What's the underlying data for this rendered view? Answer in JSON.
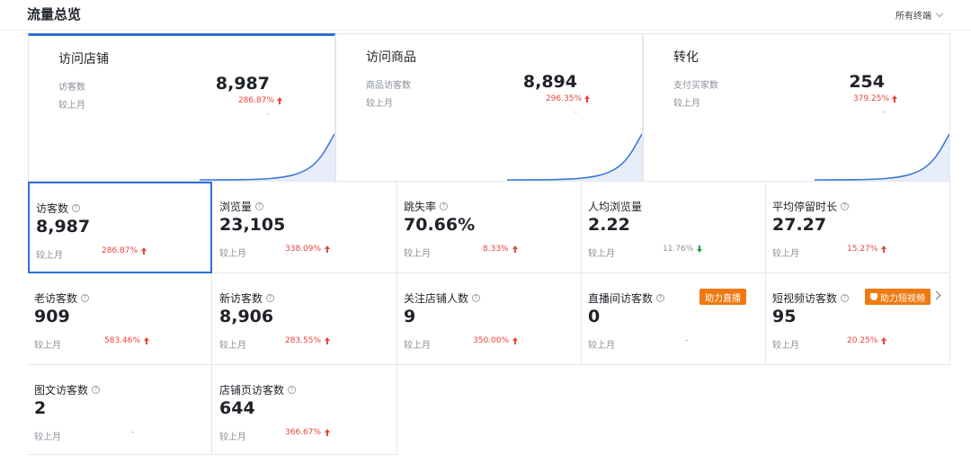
{
  "header": {
    "title": "流量总览",
    "terminal": "所有终端"
  },
  "top_cards": [
    {
      "name": "访问店铺",
      "metric_label": "访客数",
      "value": "8,987",
      "compare_label": "较上月",
      "pct": "286.87%",
      "dash": "-"
    },
    {
      "name": "访问商品",
      "metric_label": "商品访客数",
      "value": "8,894",
      "compare_label": "较上月",
      "pct": "296.35%",
      "dash": "-"
    },
    {
      "name": "转化",
      "metric_label": "支付买家数",
      "value": "254",
      "compare_label": "较上月",
      "pct": "379.25%",
      "dash": "-"
    }
  ],
  "metrics": [
    {
      "label": "访客数",
      "value": "8,987",
      "compare_label": "较上月",
      "pct": "286.87%",
      "trend": "up"
    },
    {
      "label": "浏览量",
      "value": "23,105",
      "compare_label": "较上月",
      "pct": "338.09%",
      "trend": "up"
    },
    {
      "label": "跳失率",
      "value": "70.66%",
      "compare_label": "较上月",
      "pct": "8.33%",
      "trend": "up"
    },
    {
      "label": "人均浏览量",
      "value": "2.22",
      "compare_label": "较上月",
      "pct": "11.76%",
      "trend": "down"
    },
    {
      "label": "平均停留时长",
      "value": "27.27",
      "compare_label": "较上月",
      "pct": "15.27%",
      "trend": "up"
    },
    {
      "label": "老访客数",
      "value": "909",
      "compare_label": "较上月",
      "pct": "583.46%",
      "trend": "up"
    },
    {
      "label": "新访客数",
      "value": "8,906",
      "compare_label": "较上月",
      "pct": "283.55%",
      "trend": "up"
    },
    {
      "label": "关注店铺人数",
      "value": "9",
      "compare_label": "较上月",
      "pct": "350.00%",
      "trend": "up"
    },
    {
      "label": "直播间访客数",
      "value": "0",
      "compare_label": "较上月",
      "pct": "-",
      "trend": "none",
      "badge": "助力直播"
    },
    {
      "label": "短视频访客数",
      "value": "95",
      "compare_label": "较上月",
      "pct": "20.25%",
      "trend": "up",
      "badge": "助力短视频"
    },
    {
      "label": "图文访客数",
      "value": "2",
      "compare_label": "较上月",
      "pct": "-",
      "trend": "none"
    },
    {
      "label": "店铺页访客数",
      "value": "644",
      "compare_label": "较上月",
      "pct": "366.67%",
      "trend": "up"
    }
  ],
  "colors": {
    "accent": "#2f6fd6",
    "up": "#e8453c",
    "down": "#1e9e48",
    "badge": "#ef7a12"
  }
}
